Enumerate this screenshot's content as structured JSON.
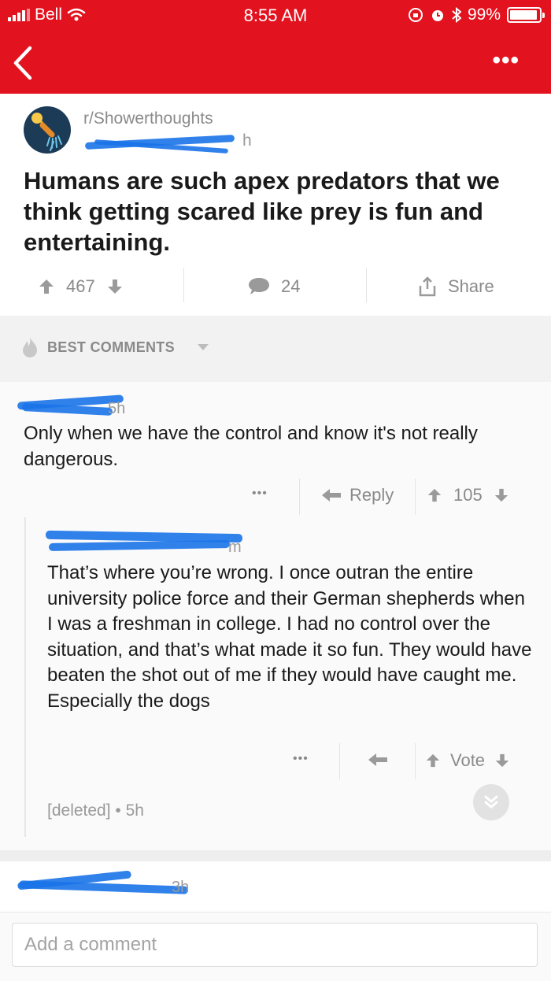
{
  "status_bar": {
    "carrier": "Bell",
    "time": "8:55 AM",
    "battery": "99%"
  },
  "nav": {
    "back_icon": "chevron-left-icon",
    "more_label": "•••"
  },
  "post": {
    "subreddit": "r/Showerthoughts",
    "age": "h",
    "title": "Humans are such apex predators that we think getting scared like prey is fun and entertaining.",
    "score": "467",
    "comments_count": "24",
    "share_label": "Share"
  },
  "sort": {
    "label": "BEST COMMENTS"
  },
  "comments": [
    {
      "age": "5h",
      "body": "Only when we have the control and know it's not really dangerous.",
      "more_label": "•••",
      "reply_label": "Reply",
      "score": "105"
    },
    {
      "age": "m",
      "body": "That’s where you’re wrong.  I once outran the entire university police force and their German shepherds when I was a freshman in college.  I had no control over the situation, and that’s what made it so fun.  They would have beaten the shot out of me if they would have caught me. Especially the dogs",
      "more_label": "•••",
      "vote_label": "Vote"
    }
  ],
  "deleted_comment": {
    "author": "[deleted]",
    "separator": "•",
    "age": "5h"
  },
  "next_comment": {
    "age": "3h"
  },
  "composer": {
    "placeholder": "Add a comment"
  },
  "colors": {
    "brand": "#e3121f",
    "muted": "#8a8a8a",
    "redaction": "#1a73e8"
  }
}
